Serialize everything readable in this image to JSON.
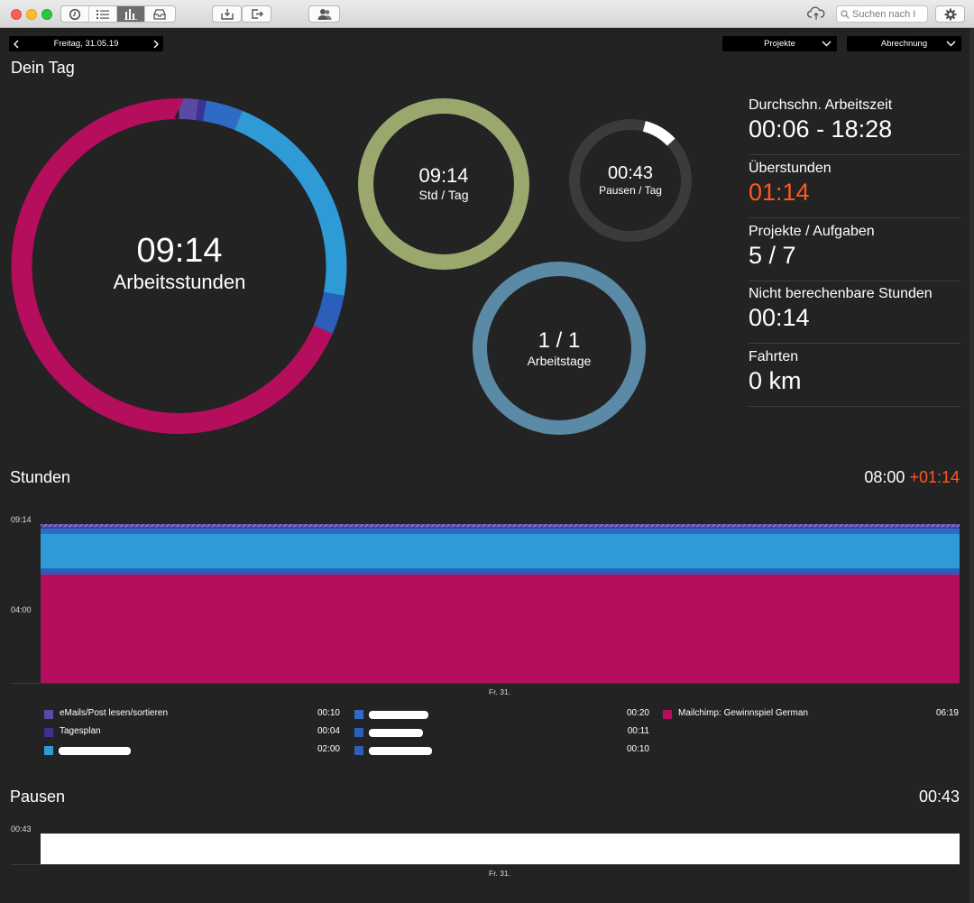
{
  "toolbar": {
    "search_placeholder": "Suchen nach I"
  },
  "nav": {
    "date": "Freitag, 31.05.19",
    "projects_dropdown": "Projekte",
    "billing_dropdown": "Abrechnung"
  },
  "day": {
    "title": "Dein Tag",
    "main_ring": {
      "value": "09:14",
      "label": "Arbeitsstunden"
    },
    "hours_ring": {
      "value": "09:14",
      "label": "Std / Tag",
      "overtime_fraction": 0.135
    },
    "pause_ring": {
      "value": "00:43",
      "label": "Pausen / Tag",
      "fraction": 0.09
    },
    "days_ring": {
      "value": "1 / 1",
      "label": "Arbeitstage",
      "fraction": 1.0
    }
  },
  "stats": [
    {
      "label": "Durchschn. Arbeitszeit",
      "value": "00:06 - 18:28",
      "accent": false
    },
    {
      "label": "Überstunden",
      "value": "01:14",
      "accent": true
    },
    {
      "label": "Projekte / Aufgaben",
      "value": "5 / 7",
      "accent": false
    },
    {
      "label": "Nicht berechenbare Stunden",
      "value": "00:14",
      "accent": false
    },
    {
      "label": "Fahrten",
      "value": "0 km",
      "accent": false
    }
  ],
  "hours": {
    "title": "Stunden",
    "target": "08:00",
    "overtime": "+01:14",
    "y_top_label": "09:14",
    "y_mid_label": "04:00",
    "x_label": "Fr. 31.",
    "legend": [
      {
        "label": "eMails/Post lesen/sortieren",
        "time": "00:10",
        "color": "#5b4aa3",
        "redacted": false
      },
      {
        "label": "Tagesplan",
        "time": "00:04",
        "color": "#3b3394",
        "redacted": false
      },
      {
        "label": "",
        "time": "02:00",
        "color": "#2e9ad6",
        "redacted": true
      },
      {
        "label": "",
        "time": "00:20",
        "color": "#2d6bc4",
        "redacted": true
      },
      {
        "label": "",
        "time": "00:11",
        "color": "#2960bd",
        "redacted": true
      },
      {
        "label": "",
        "time": "00:10",
        "color": "#2d5fb8",
        "redacted": true
      },
      {
        "label": "Mailchimp: Gewinnspiel German",
        "time": "06:19",
        "color": "#b40e5d",
        "redacted": false
      }
    ]
  },
  "pauses": {
    "title": "Pausen",
    "total": "00:43",
    "y_label": "00:43",
    "x_label": "Fr. 31."
  },
  "chart_data": {
    "type": "bar",
    "categories": [
      "Fr. 31."
    ],
    "stacked": true,
    "ylim": [
      0,
      9.23
    ],
    "series": [
      {
        "name": "Mailchimp: Gewinnspiel German",
        "values": [
          6.32
        ],
        "color": "#b40e5d"
      },
      {
        "name": "",
        "values": [
          0.17
        ],
        "color": "#2d5fb8"
      },
      {
        "name": "",
        "values": [
          0.18
        ],
        "color": "#2960bd"
      },
      {
        "name": "",
        "values": [
          2.0
        ],
        "color": "#2e9ad6"
      },
      {
        "name": "",
        "values": [
          0.33
        ],
        "color": "#2d6bc4"
      },
      {
        "name": "Tagesplan",
        "values": [
          0.07
        ],
        "color": "#3b3394"
      },
      {
        "name": "eMails/Post lesen/sortieren",
        "values": [
          0.17
        ],
        "color": "#5b4aa3"
      }
    ]
  }
}
